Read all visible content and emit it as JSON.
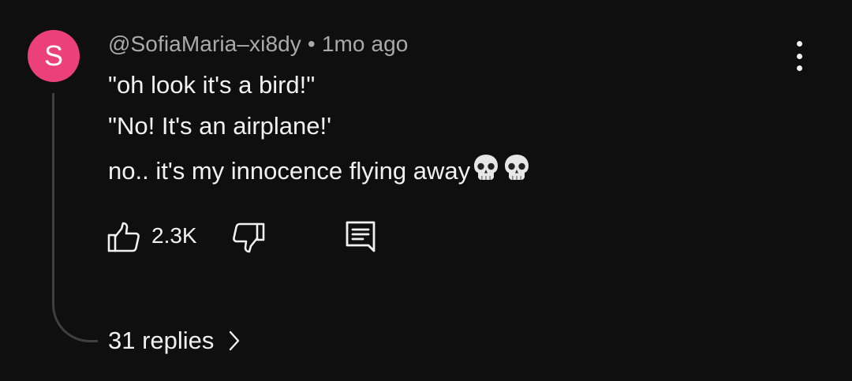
{
  "comment": {
    "avatar_letter": "S",
    "avatar_color": "#ec407a",
    "author": "@SofiaMaria–xi8dy",
    "separator": "•",
    "age": "1mo ago",
    "lines": [
      "\"oh look it's a bird!\"",
      "\"No! It's an airplane!'",
      "no.. it's my innocence flying away"
    ],
    "emoji_icons": [
      "skull-icon",
      "skull-icon"
    ],
    "likes": "2.3K",
    "replies_label": "31 replies"
  },
  "icons": {
    "menu": "more-vert-icon",
    "like": "thumbs-up-icon",
    "dislike": "thumbs-down-icon",
    "reply": "reply-comment-icon",
    "expand": "chevron-right-icon"
  },
  "colors": {
    "background": "#0f0f0f",
    "text": "#f1f1f1",
    "meta_text": "#aaaaaa",
    "thread_line": "#3f3f3f"
  }
}
